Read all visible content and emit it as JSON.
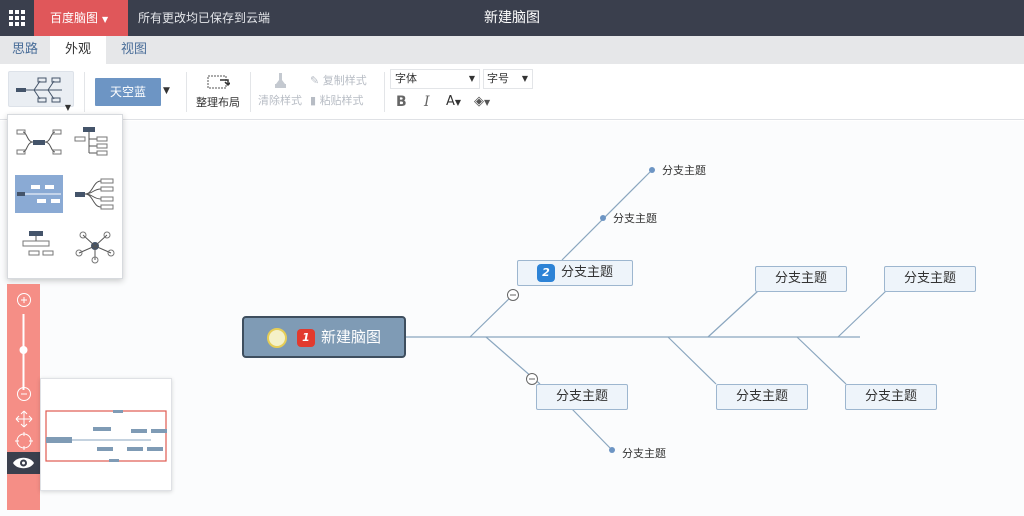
{
  "header": {
    "brand_label": "百度脑图",
    "save_status": "所有更改均已保存到云端",
    "document_title": "新建脑图"
  },
  "tabs": [
    {
      "label": "思路",
      "active": false
    },
    {
      "label": "外观",
      "active": true
    },
    {
      "label": "视图",
      "active": false
    }
  ],
  "toolbar": {
    "theme_label": "天空蓝",
    "arrange_label": "整理布局",
    "clear_style_label": "清除样式",
    "copy_style_label": "复制样式",
    "paste_style_label": "粘贴样式",
    "font_family_label": "字体",
    "font_size_label": "字号",
    "bold_label": "B",
    "italic_label": "I",
    "font_color_label": "A"
  },
  "layout_panel": {
    "options": [
      "mindmap",
      "org-tree",
      "fish-bone-right",
      "tree-right",
      "filetree",
      "radial"
    ],
    "selected": "fish-bone-right"
  },
  "mindmap": {
    "root": {
      "label": "新建脑图",
      "priority": "1",
      "progress": "in-progress"
    },
    "main_topic": {
      "label": "分支主题",
      "priority": "2"
    },
    "branch_label": "分支主题"
  },
  "colors": {
    "header_bg": "#3a3f4d",
    "brand_accent": "#e0575a",
    "theme_button": "#6d95c4",
    "root_fill": "#7f9bb5",
    "zoom_bar": "#f58e86"
  }
}
